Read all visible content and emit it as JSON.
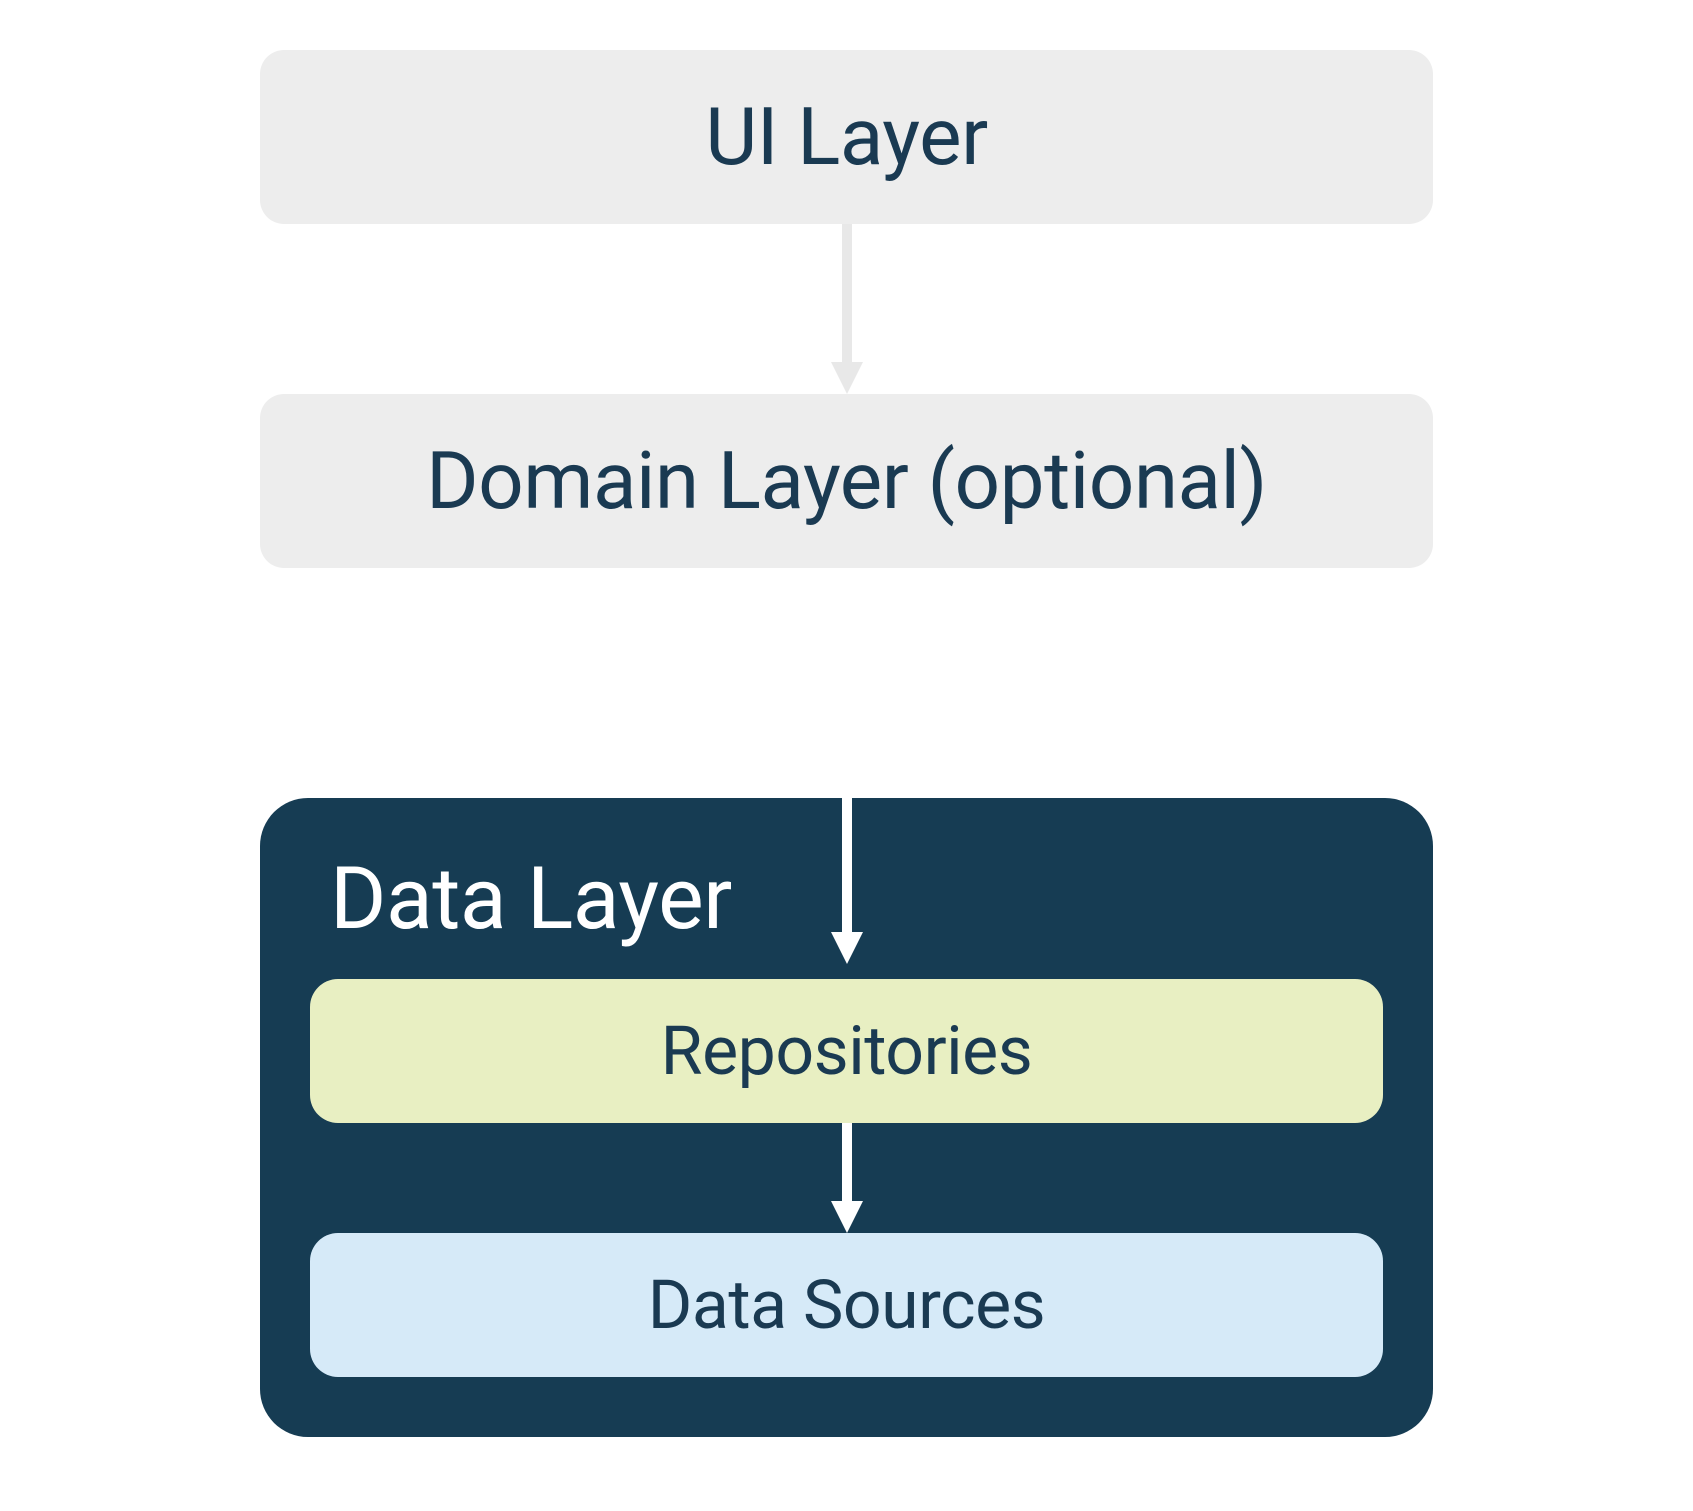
{
  "diagram": {
    "layers": {
      "ui": "UI Layer",
      "domain": "Domain Layer (optional)",
      "data": {
        "title": "Data Layer",
        "repositories": "Repositories",
        "dataSources": "Data Sources"
      }
    }
  },
  "colors": {
    "light_box_bg": "#ededed",
    "dark_container_bg": "#163c53",
    "repo_bg": "#e8efc2",
    "source_bg": "#d6eaf8",
    "text_dark": "#1a3a52",
    "text_light": "#ffffff",
    "arrow_light": "#e8e8e8",
    "arrow_white": "#ffffff"
  }
}
